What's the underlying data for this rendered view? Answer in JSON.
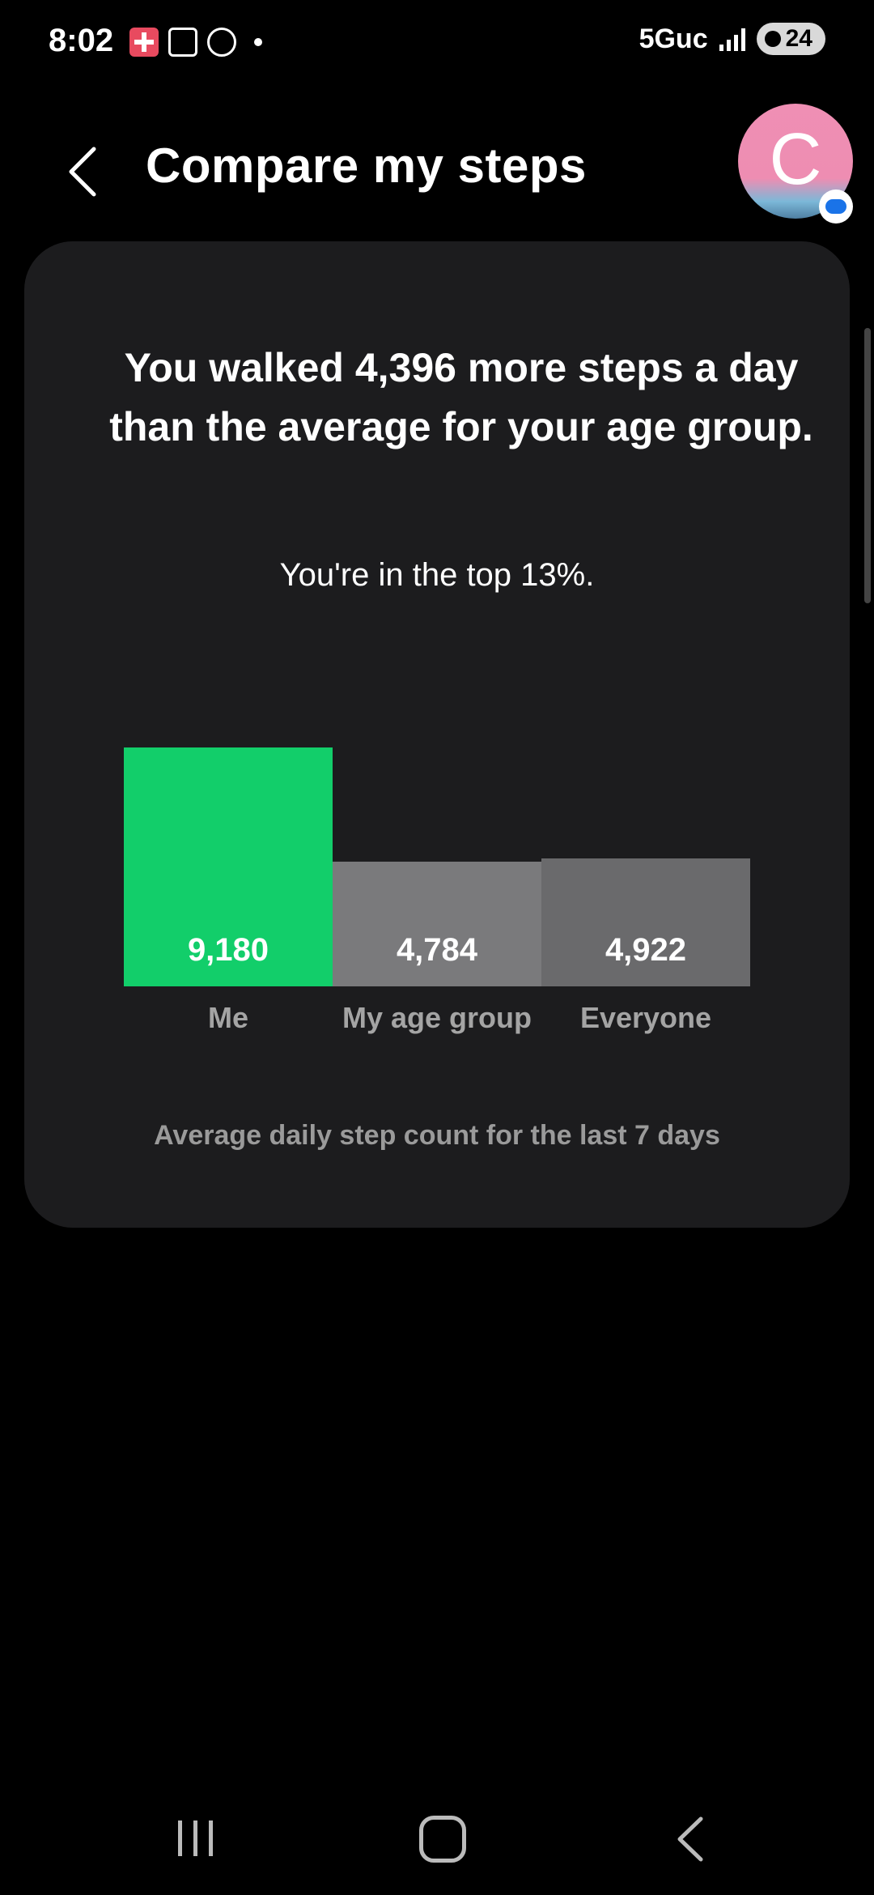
{
  "status_bar": {
    "time": "8:02",
    "network": "5Guc",
    "battery": "24",
    "icons": [
      "health-icon",
      "scan-icon",
      "fingerprint-icon",
      "notification-dot-icon"
    ]
  },
  "header": {
    "title": "Compare my steps",
    "avatar_letter": "C"
  },
  "card": {
    "headline": "You walked 4,396 more steps a day than the average for your age group.",
    "subline": "You're in the top 13%.",
    "footnote": "Average daily step count for the last 7 days"
  },
  "colors": {
    "me": "#12ce6a",
    "age_group": "#7a7a7c",
    "everyone": "#6a6a6c",
    "card_bg": "#1c1c1e"
  },
  "chart_data": {
    "type": "bar",
    "categories": [
      "Me",
      "My age group",
      "Everyone"
    ],
    "values": [
      9180,
      4784,
      4922
    ],
    "value_labels": [
      "9,180",
      "4,784",
      "4,922"
    ]
  }
}
